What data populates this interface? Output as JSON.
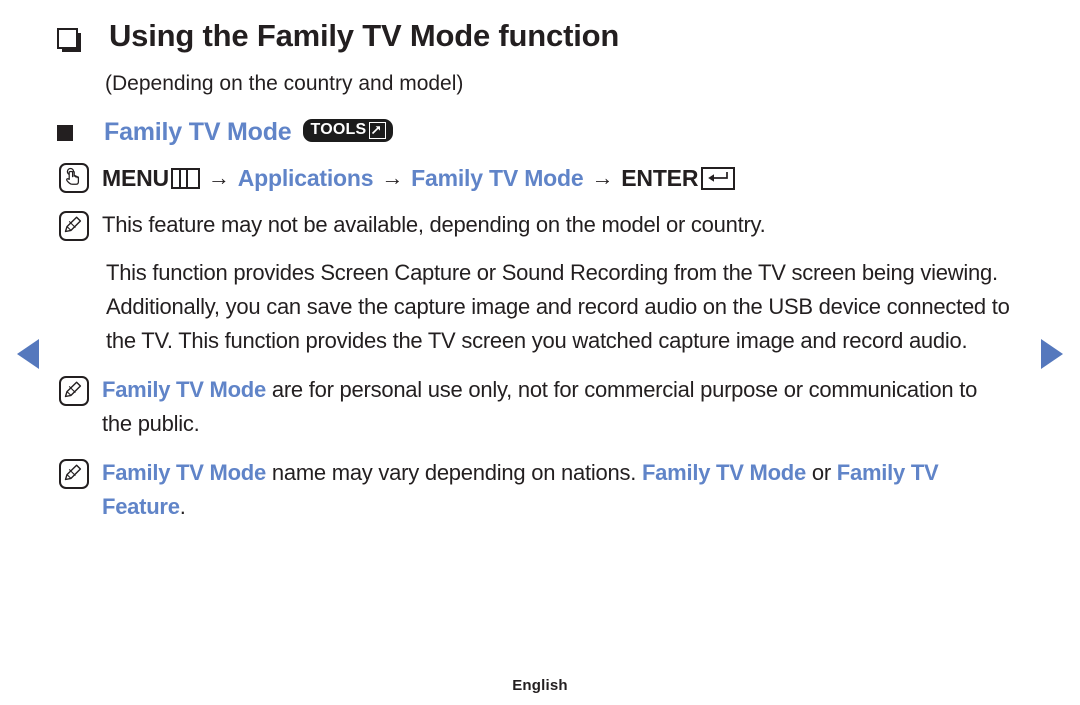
{
  "nav": {
    "prev_label": "previous-page",
    "next_label": "next-page",
    "arrow_color": "#5578bd"
  },
  "heading": {
    "title": "Using the Family TV Mode function",
    "subtitle": "(Depending on the country and model)",
    "bullet_icon": "hollow-square-bullet"
  },
  "subheading": {
    "text": "Family TV Mode",
    "bullet_icon": "solid-square-bullet",
    "badge": {
      "label": "TOOLS",
      "icon": "tools-arrow-icon",
      "background": "#1c1c1c",
      "text_color": "#ffffff"
    },
    "color": "#6084c8"
  },
  "menu_path": {
    "press_icon": "hand-press-icon",
    "menu_label": "MENU",
    "menu_glyph": "menu-button-icon",
    "arrow": "→",
    "step_applications": "Applications",
    "step_family_tv_mode": "Family TV Mode",
    "enter_label": "ENTER",
    "enter_glyph": "enter-return-icon"
  },
  "notes": [
    {
      "icon": "note-pen-icon",
      "segments": [
        {
          "text": "This feature may not be available, depending on the model or country.",
          "style": "plain"
        }
      ]
    },
    {
      "icon": "note-pen-icon",
      "segments": [
        {
          "text": "Family TV Mode",
          "style": "blue-bold"
        },
        {
          "text": " are for personal use only, not for commercial purpose or communication to the public.",
          "style": "plain"
        }
      ]
    },
    {
      "icon": "note-pen-icon",
      "segments": [
        {
          "text": "Family TV Mode",
          "style": "blue-bold"
        },
        {
          "text": " name may vary depending on nations. ",
          "style": "plain"
        },
        {
          "text": "Family TV Mode",
          "style": "blue-bold"
        },
        {
          "text": " or ",
          "style": "plain"
        },
        {
          "text": "Family TV Feature",
          "style": "blue-bold"
        },
        {
          "text": ".",
          "style": "plain"
        }
      ]
    }
  ],
  "body": {
    "paragraph": "This function provides Screen Capture or Sound Recording from the TV screen being viewing. Additionally, you can save the capture image and record audio on the USB device connected to the TV. This function provides the TV screen you watched capture image and record audio."
  },
  "footer": {
    "language": "English"
  },
  "colors": {
    "accent_blue": "#6084c8",
    "text": "#231f20",
    "background": "#ffffff"
  }
}
